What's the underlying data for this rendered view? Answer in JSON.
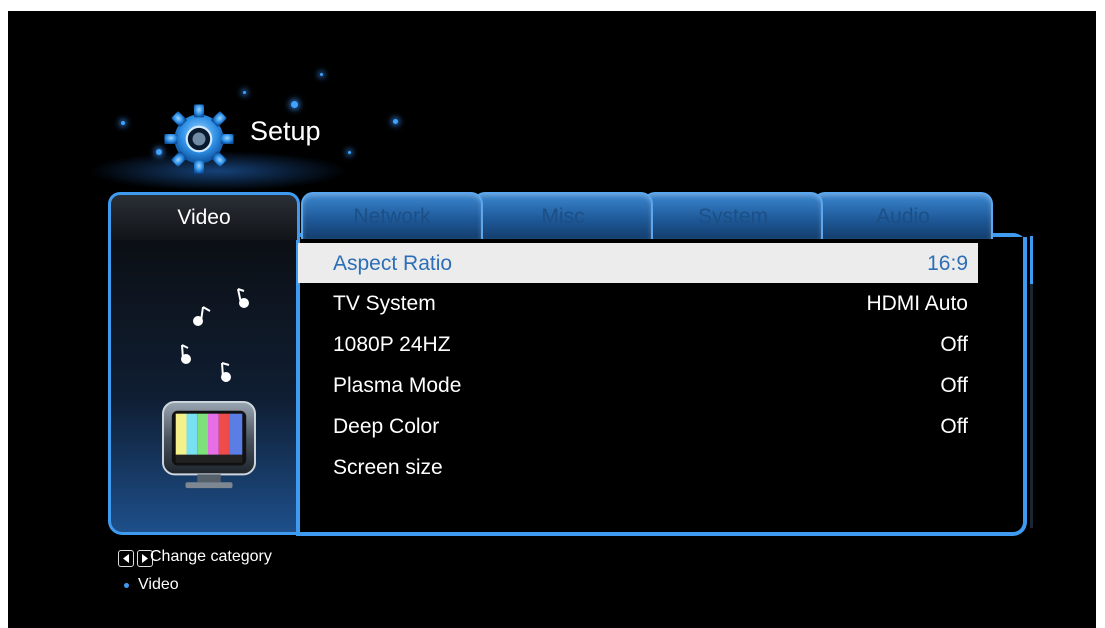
{
  "header": {
    "title": "Setup",
    "icon": "gear-icon"
  },
  "tabs": [
    {
      "label": "Video",
      "active": true
    },
    {
      "label": "Network",
      "active": false
    },
    {
      "label": "Misc",
      "active": false
    },
    {
      "label": "System",
      "active": false
    },
    {
      "label": "Audio",
      "active": false
    }
  ],
  "settings": [
    {
      "label": "Aspect Ratio",
      "value": "16:9",
      "selected": true
    },
    {
      "label": "TV System",
      "value": "HDMI Auto"
    },
    {
      "label": "1080P 24HZ",
      "value": "Off"
    },
    {
      "label": "Plasma Mode",
      "value": "Off"
    },
    {
      "label": "Deep Color",
      "value": "Off"
    },
    {
      "label": "Screen size",
      "value": ""
    }
  ],
  "footer": {
    "hint": "Change category",
    "current_category": "Video",
    "icons": [
      "left-arrow-key-icon",
      "right-arrow-key-icon"
    ]
  },
  "colors": {
    "accent": "#3f9bf0",
    "selection_bg": "#ececec",
    "selection_text": "#2c6fb7"
  }
}
